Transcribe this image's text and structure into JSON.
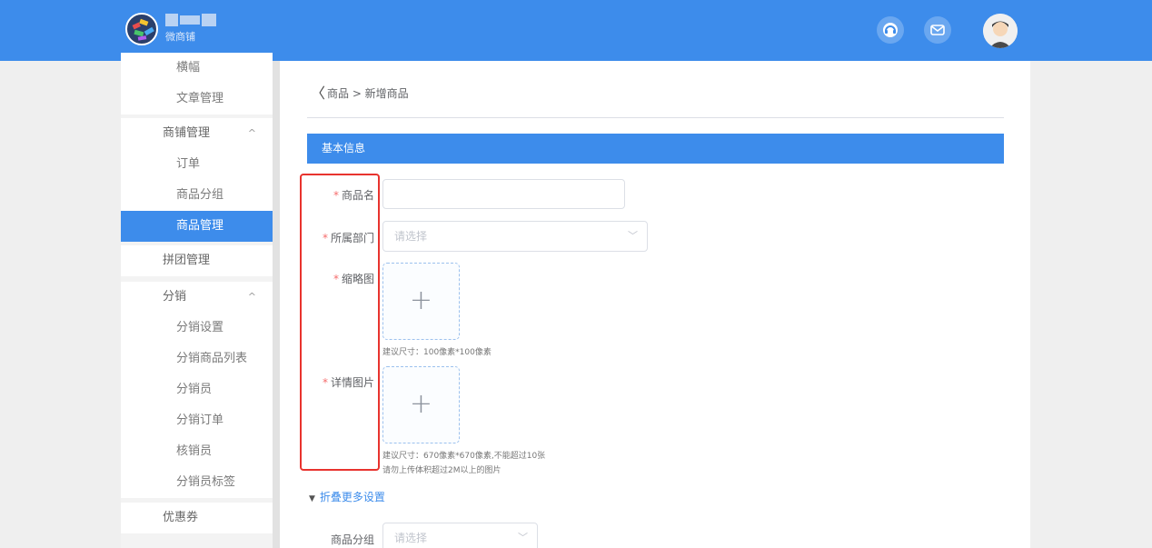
{
  "header": {
    "brand_name": "微商铺",
    "colors": {
      "primary": "#3d8ceb",
      "required": "#f56c6c",
      "highlight": "#e8332e"
    },
    "icons": [
      "logo-icon",
      "customer-service-icon",
      "mail-icon",
      "user-avatar-icon"
    ]
  },
  "sidebar": {
    "banner": "横幅",
    "article_mgmt": "文章管理",
    "shop_mgmt": "商铺管理",
    "orders": "订单",
    "product_group": "商品分组",
    "product_mgmt": "商品管理",
    "group_buy_mgmt": "拼团管理",
    "distribution": "分销",
    "dist_settings": "分销设置",
    "dist_product_list": "分销商品列表",
    "distributor": "分销员",
    "dist_orders": "分销订单",
    "verifier": "核销员",
    "dist_tags": "分销员标签",
    "coupons": "优惠券",
    "caret_up": "^"
  },
  "breadcrumb": "商品 > 新增商品",
  "section_title": "基本信息",
  "form": {
    "required_mark": "*",
    "name_label": "商品名",
    "dept_label": "所属部门",
    "dept_placeholder": "请选择",
    "thumb_label": "缩略图",
    "thumb_hint": "建议尺寸：100像素*100像素",
    "detail_label": "详情图片",
    "detail_hint_1": "建议尺寸：670像素*670像素,不能超过10张",
    "detail_hint_2": "请勿上传体积超过2M以上的图片",
    "more_settings": "折叠更多设置",
    "group_label": "商品分组",
    "group_placeholder": "请选择"
  }
}
